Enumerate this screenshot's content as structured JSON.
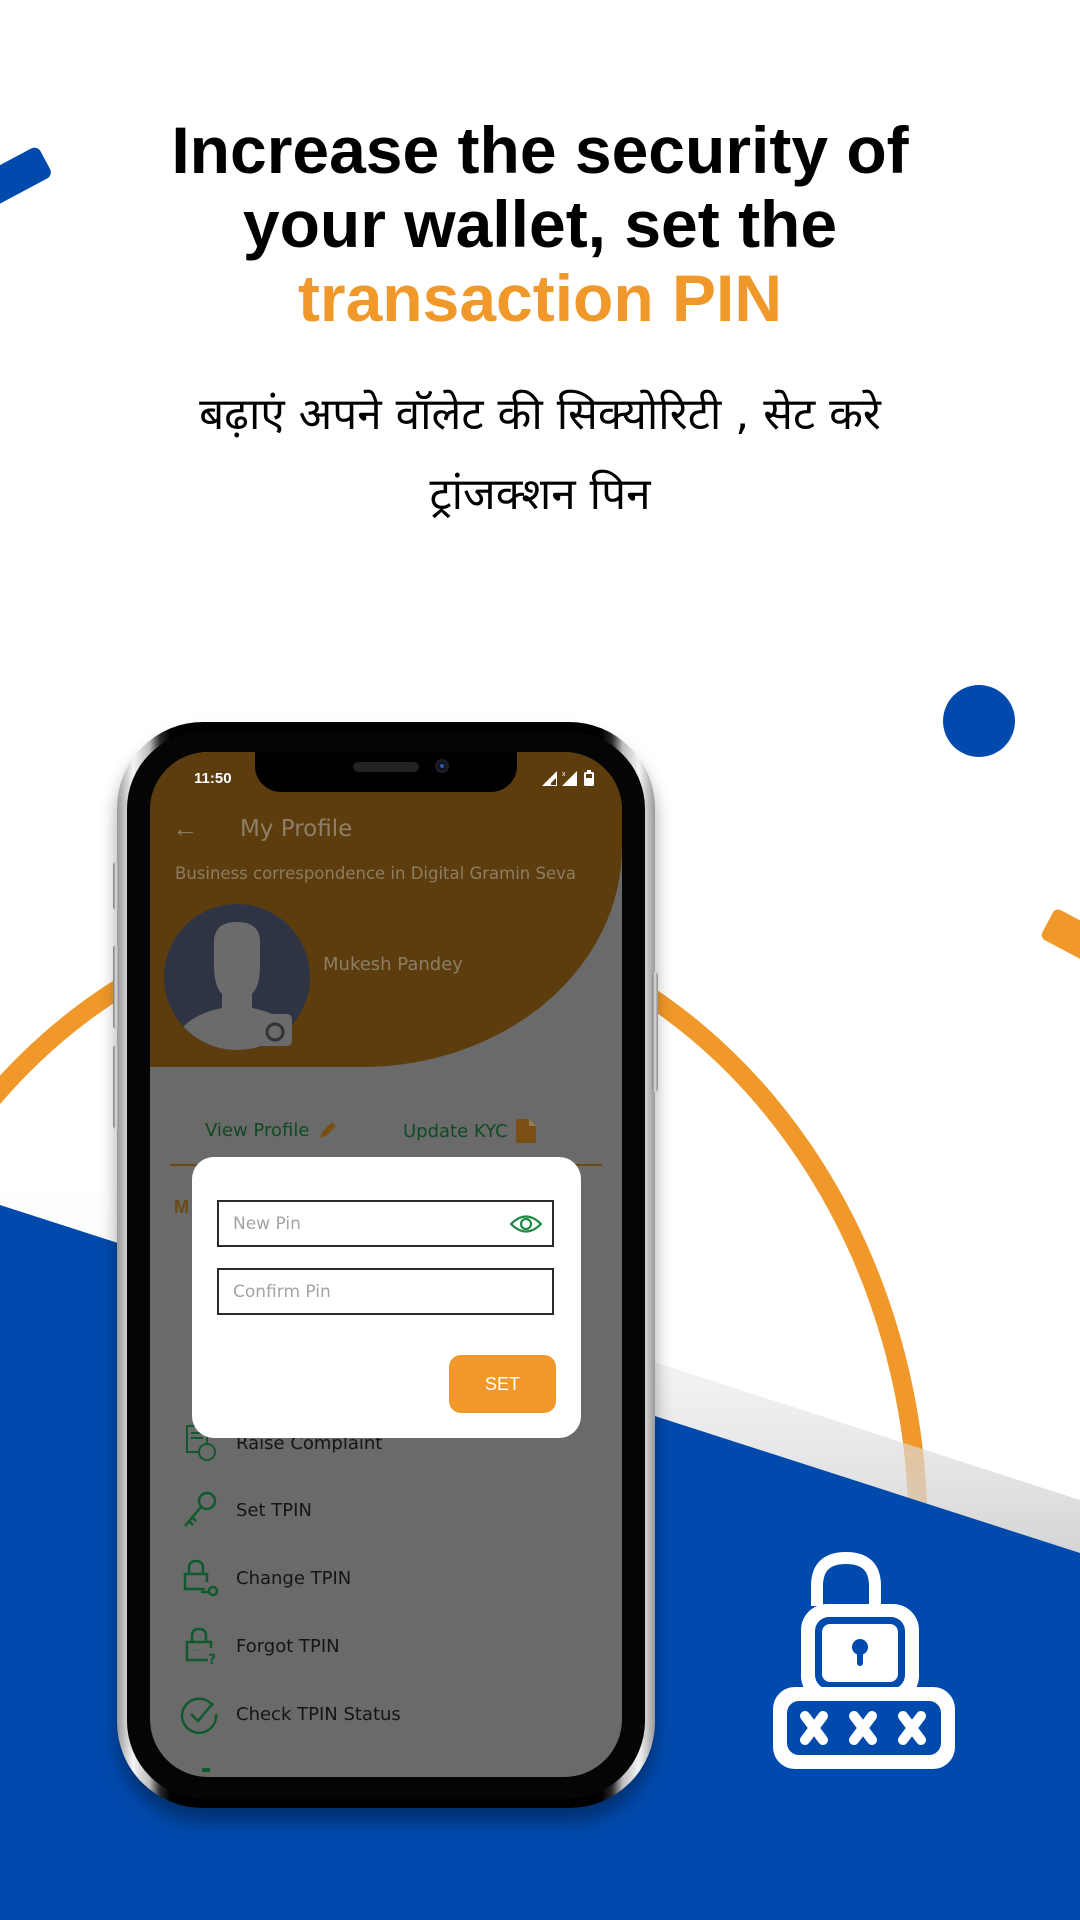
{
  "headline": {
    "line1": "Increase the security of",
    "line2": "your wallet, set the",
    "line3_accent": "transaction PIN"
  },
  "hindi_subtitle": {
    "line1": "बढ़ाएं अपने वॉलेट की सिक्योरिटी , सेट करे",
    "line2": "ट्रांजक्शन पिन"
  },
  "colors": {
    "brand_blue": "#004AAD",
    "accent_orange": "#F0992A",
    "menu_icon_green": "#0f5a2c"
  },
  "phone": {
    "status_bar": {
      "time": "11:50",
      "icons": [
        "signal-icon",
        "signal-no-data-icon",
        "battery-icon"
      ]
    },
    "app_bar": {
      "back_icon": "arrow-left-icon",
      "title": "My Profile"
    },
    "subtitle": "Business correspondence in Digital Gramin Seva",
    "user_name": "Mukesh Pandey",
    "actions": {
      "view_profile": "View Profile",
      "update_kyc": "Update KYC"
    },
    "section_initial": "M",
    "menu_items": [
      {
        "label": "Raise Complaint",
        "icon": "complaint-icon"
      },
      {
        "label": "Set TPIN",
        "icon": "key-icon"
      },
      {
        "label": "Change TPIN",
        "icon": "lock-key-icon"
      },
      {
        "label": "Forgot TPIN",
        "icon": "lock-question-icon"
      },
      {
        "label": "Check TPIN Status",
        "icon": "check-circle-icon"
      }
    ],
    "dialog": {
      "new_pin": {
        "placeholder": "New Pin",
        "value": ""
      },
      "confirm_pin": {
        "placeholder": "Confirm Pin",
        "value": ""
      },
      "set_button": "SET"
    }
  }
}
